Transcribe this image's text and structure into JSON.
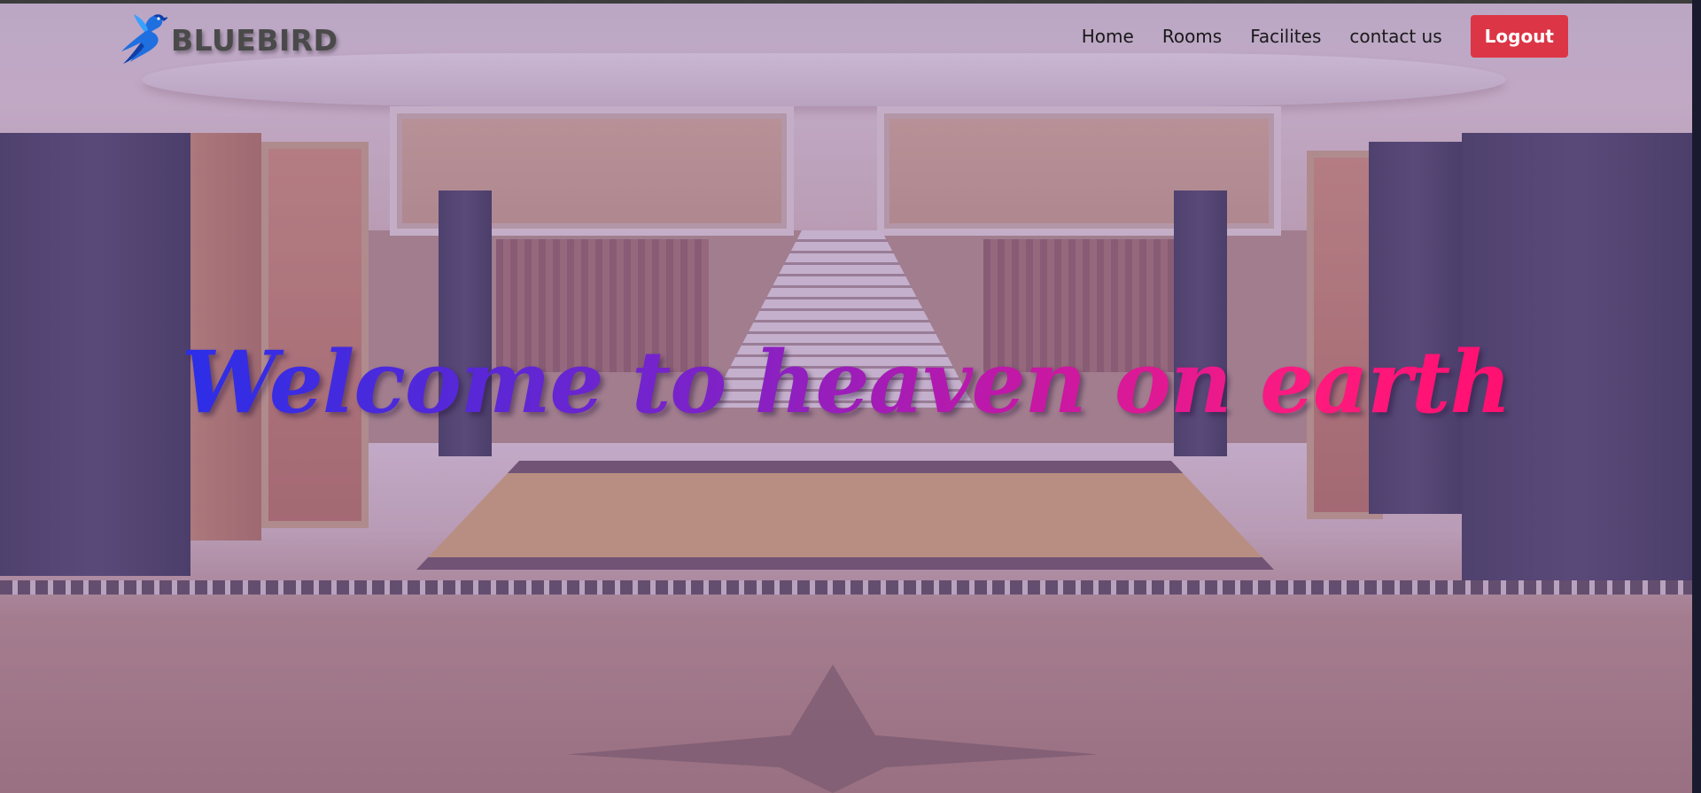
{
  "brand": {
    "name": "BLUEBIRD",
    "logo_icon": "bluebird-logo-icon"
  },
  "nav": {
    "links": [
      {
        "label": "Home"
      },
      {
        "label": "Rooms"
      },
      {
        "label": "Facilites"
      },
      {
        "label": "contact us"
      }
    ],
    "logout_label": "Logout"
  },
  "hero": {
    "headline": "Welcome to heaven on earth"
  },
  "colors": {
    "logout_button": "#dc3545",
    "headline_gradient_start": "#2b2ee8",
    "headline_gradient_mid": "#c018a8",
    "headline_gradient_end": "#ff1070"
  }
}
